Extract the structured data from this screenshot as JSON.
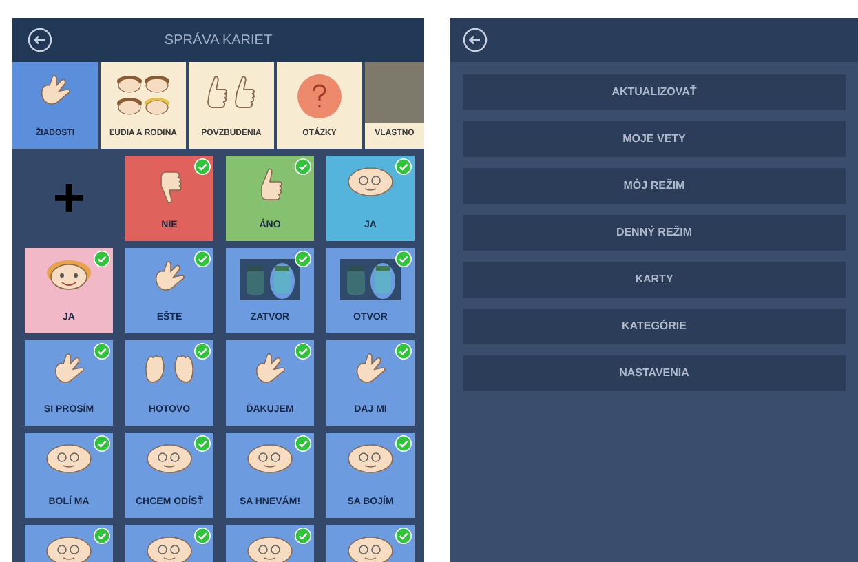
{
  "left_screen": {
    "title": "SPRÁVA KARIET",
    "categories": [
      {
        "label": "ŽIADOSTI",
        "selected": true,
        "kind": "hand"
      },
      {
        "label": "ĽUDIA A RODINA",
        "selected": false,
        "kind": "faces"
      },
      {
        "label": "POVZBUDENIA",
        "selected": false,
        "kind": "thumbs"
      },
      {
        "label": "OTÁZKY",
        "selected": false,
        "kind": "question"
      },
      {
        "label": "VLASTNO",
        "selected": false,
        "kind": "photo"
      }
    ],
    "cards": [
      {
        "kind": "add",
        "label": "+"
      },
      {
        "kind": "thumb-down",
        "label": "NIE",
        "color": "#e0625c",
        "checked": true
      },
      {
        "kind": "thumb-up",
        "label": "ÁNO",
        "color": "#86c170",
        "checked": true
      },
      {
        "kind": "face",
        "label": "JA",
        "color": "#54b4dc",
        "checked": true
      },
      {
        "kind": "girl-face",
        "label": "JA",
        "color": "#f1b8c8",
        "checked": true
      },
      {
        "kind": "hand",
        "label": "EŠTE",
        "color": "#6d9be0",
        "checked": true
      },
      {
        "kind": "jars",
        "label": "ZATVOR",
        "color": "#6d9be0",
        "checked": true
      },
      {
        "kind": "jars",
        "label": "OTVOR",
        "color": "#6d9be0",
        "checked": true
      },
      {
        "kind": "hand",
        "label": "SI PROSÍM",
        "color": "#6d9be0",
        "checked": true
      },
      {
        "kind": "hands",
        "label": "HOTOVO",
        "color": "#6d9be0",
        "checked": true
      },
      {
        "kind": "hand",
        "label": "ĎAKUJEM",
        "color": "#6d9be0",
        "checked": true
      },
      {
        "kind": "hand",
        "label": "DAJ MI",
        "color": "#6d9be0",
        "checked": true
      },
      {
        "kind": "face",
        "label": "BOLÍ MA",
        "color": "#6d9be0",
        "checked": true
      },
      {
        "kind": "face",
        "label": "CHCEM ODÍSŤ",
        "color": "#6d9be0",
        "checked": true
      },
      {
        "kind": "face",
        "label": "SA HNEVÁM!",
        "color": "#6d9be0",
        "checked": true
      },
      {
        "kind": "face",
        "label": "SA BOJÍM",
        "color": "#6d9be0",
        "checked": true
      },
      {
        "kind": "face",
        "color": "#6d9be0",
        "checked": true
      },
      {
        "kind": "face",
        "color": "#6d9be0",
        "checked": true
      },
      {
        "kind": "face",
        "color": "#6d9be0",
        "checked": true
      },
      {
        "kind": "face",
        "color": "#6d9be0",
        "checked": true
      }
    ]
  },
  "right_screen": {
    "menu": [
      "AKTUALIZOVAŤ",
      "MOJE VETY",
      "MÔJ REŽIM",
      "DENNÝ REŽIM",
      "KARTY",
      "KATEGÓRIE",
      "NASTAVENIA"
    ]
  }
}
